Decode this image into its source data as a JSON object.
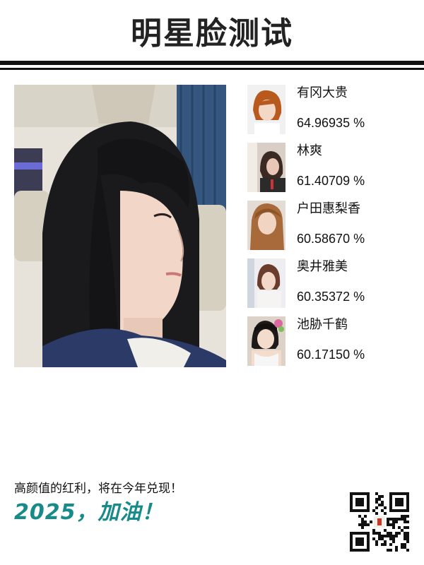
{
  "header": {
    "title": "明星脸测试"
  },
  "photo": {
    "icon": "portrait-photo"
  },
  "results": [
    {
      "name": "有冈大贵",
      "score": "64.96935 %",
      "icon": "celebrity-photo"
    },
    {
      "name": "林爽",
      "score": "61.40709 %",
      "icon": "celebrity-photo"
    },
    {
      "name": "户田惠梨香",
      "score": "60.58670 %",
      "icon": "celebrity-photo"
    },
    {
      "name": "奥井雅美",
      "score": "60.35372 %",
      "icon": "celebrity-photo"
    },
    {
      "name": "池胁千鹤",
      "score": "60.17150 %",
      "icon": "celebrity-photo"
    }
  ],
  "footer": {
    "tagline": "高颜值的红利，将在今年兑现！",
    "slogan": "2025，加油！",
    "qr_icon": "qr-code"
  },
  "colors": {
    "title": "#222222",
    "slogan": "#178a8a",
    "rule": "#111111"
  }
}
